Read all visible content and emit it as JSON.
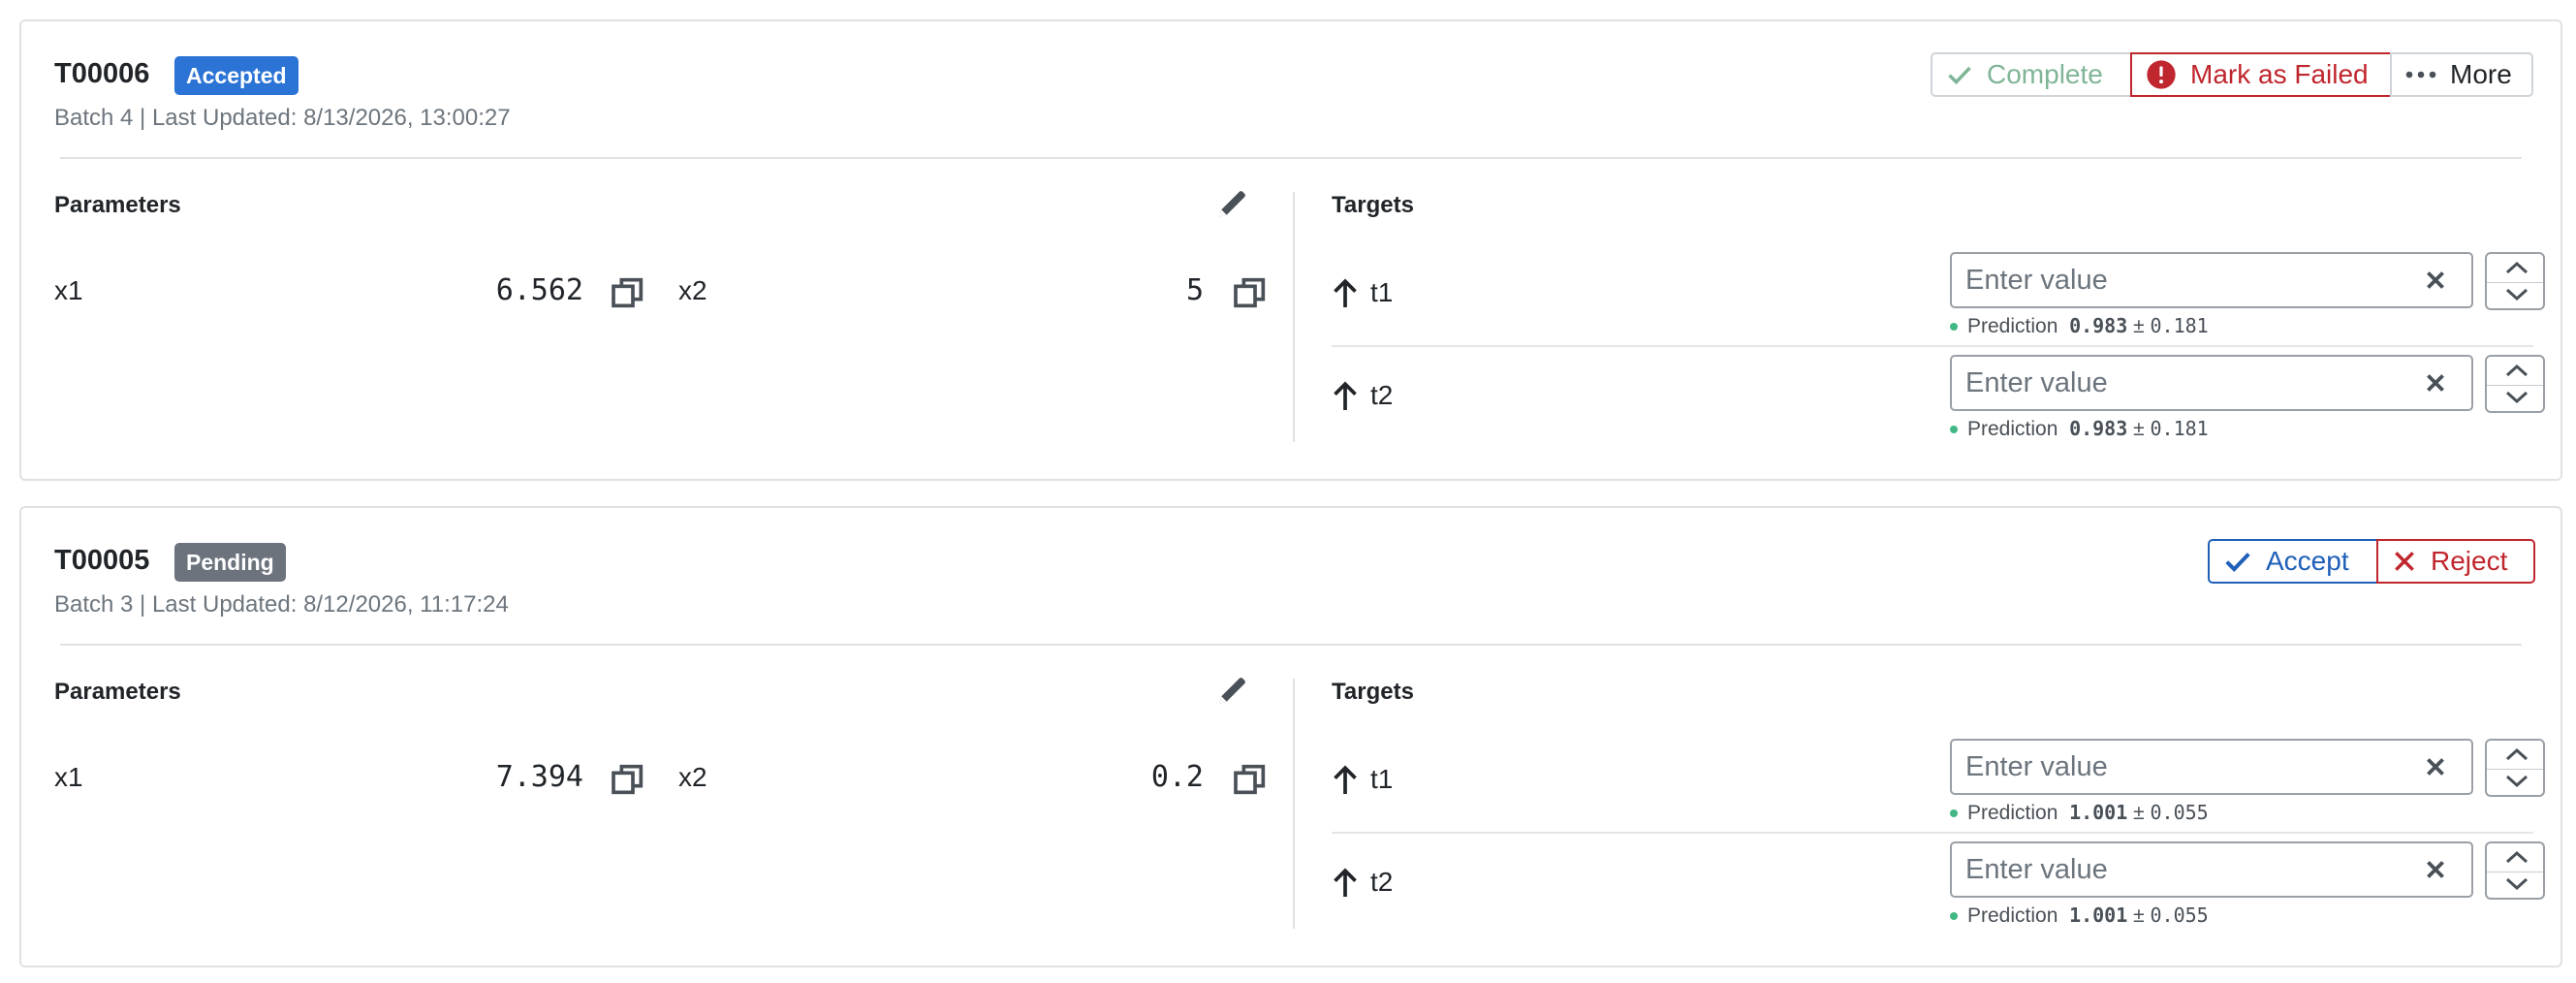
{
  "trials": [
    {
      "id": "T00006",
      "status": "Accepted",
      "subtitle": "Batch 4 | Last Updated: 8/13/2026, 13:00:27",
      "actions": {
        "complete": "Complete",
        "mark_failed": "Mark as Failed",
        "more": "More"
      },
      "parameters_label": "Parameters",
      "targets_label": "Targets",
      "params": [
        {
          "name": "x1",
          "value": "6.562"
        },
        {
          "name": "x2",
          "value": "5"
        }
      ],
      "targets": [
        {
          "name": "t1",
          "placeholder": "Enter value",
          "prediction_label": "Prediction",
          "mean": "0.983",
          "pm": "±",
          "std": "0.181"
        },
        {
          "name": "t2",
          "placeholder": "Enter value",
          "prediction_label": "Prediction",
          "mean": "0.983",
          "pm": "±",
          "std": "0.181"
        }
      ]
    },
    {
      "id": "T00005",
      "status": "Pending",
      "subtitle": "Batch 3 | Last Updated: 8/12/2026, 11:17:24",
      "actions": {
        "accept": "Accept",
        "reject": "Reject"
      },
      "parameters_label": "Parameters",
      "targets_label": "Targets",
      "params": [
        {
          "name": "x1",
          "value": "7.394"
        },
        {
          "name": "x2",
          "value": "0.2"
        }
      ],
      "targets": [
        {
          "name": "t1",
          "placeholder": "Enter value",
          "prediction_label": "Prediction",
          "mean": "1.001",
          "pm": "±",
          "std": "0.055"
        },
        {
          "name": "t2",
          "placeholder": "Enter value",
          "prediction_label": "Prediction",
          "mean": "1.001",
          "pm": "±",
          "std": "0.055"
        }
      ]
    }
  ],
  "icons": {
    "edit": "pencil-icon",
    "copy": "copy-icon",
    "target_direction": "arrow-up-icon",
    "clear": "close-icon",
    "complete": "check-icon",
    "mark_failed": "exclamation-circle-icon",
    "more": "ellipsis-icon",
    "accept": "check-icon",
    "reject": "close-icon"
  },
  "colors": {
    "accepted_badge": "#2b74d6",
    "pending_badge": "#6c737d",
    "complete_green": "#7fb596",
    "failed_red": "#c0262d",
    "accept_blue": "#1f5fb8",
    "reject_red": "#c0262d",
    "prediction_dot": "#41b883"
  }
}
